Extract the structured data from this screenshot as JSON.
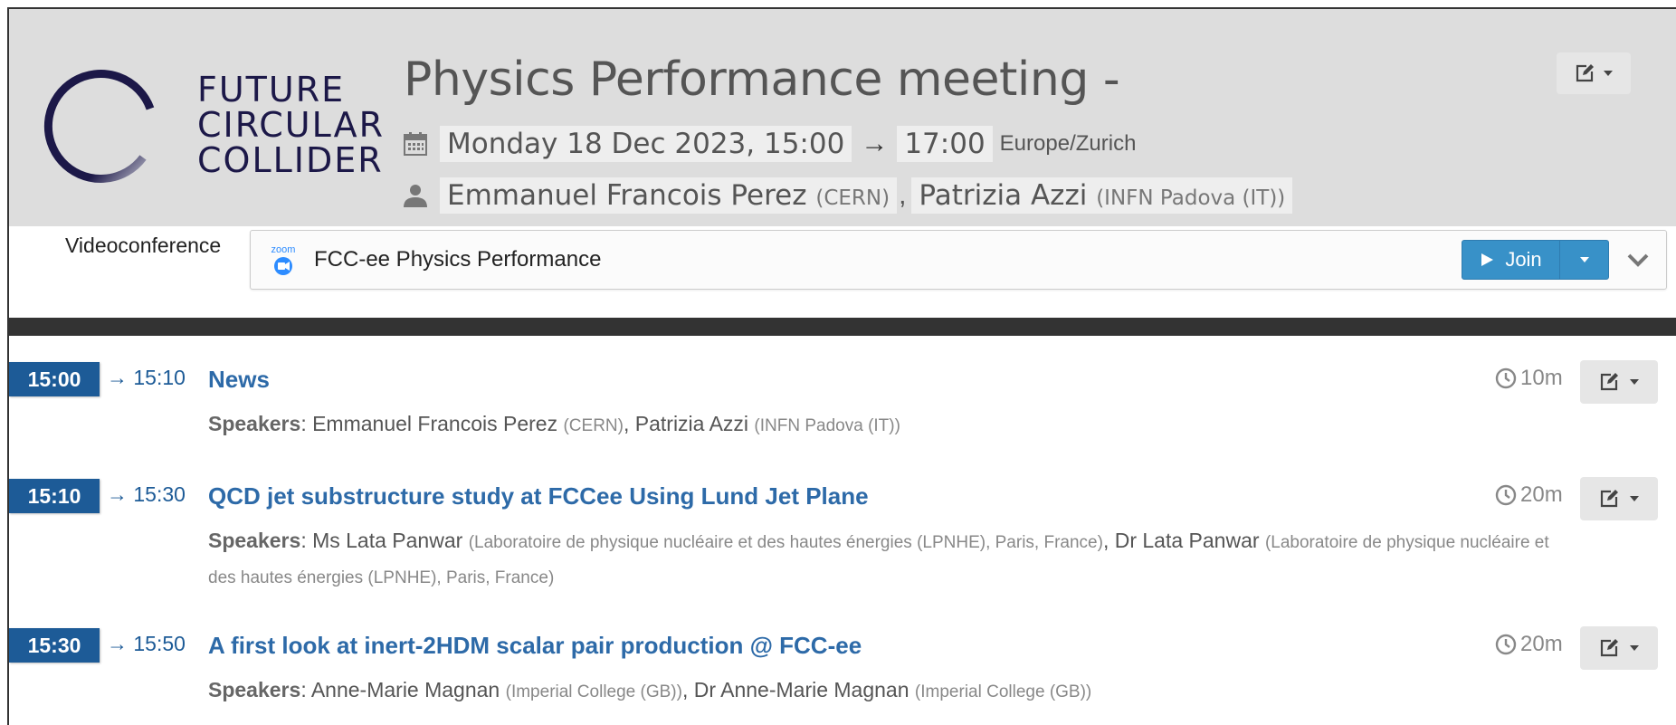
{
  "header": {
    "logo_lines": [
      "FUTURE",
      "CIRCULAR",
      "COLLIDER"
    ],
    "title": "Physics Performance meeting -",
    "date_start": "Monday 18 Dec 2023, 15:00",
    "arrow": "→",
    "date_end": "17:00",
    "timezone": "Europe/Zurich",
    "chairs": [
      {
        "name": "Emmanuel Francois Perez",
        "affiliation": "(CERN)"
      },
      {
        "name": "Patrizia Azzi",
        "affiliation": "(INFN Padova (IT))"
      }
    ],
    "chair_separator": ","
  },
  "videoconference": {
    "label": "Videoconference",
    "zoom_text": "zoom",
    "room_name": "FCC-ee Physics Performance",
    "join_label": "Join"
  },
  "timetable": [
    {
      "start": "15:00",
      "end": "→ 15:10",
      "title": "News",
      "speakers_label": "Speakers",
      "speakers": [
        {
          "name": "Emmanuel Francois Perez",
          "affiliation": "(CERN)"
        },
        {
          "name": "Patrizia Azzi",
          "affiliation": "(INFN Padova (IT))"
        }
      ],
      "duration": "10m"
    },
    {
      "start": "15:10",
      "end": "→ 15:30",
      "title": "QCD jet substructure study at FCCee Using Lund Jet Plane",
      "speakers_label": "Speakers",
      "speakers": [
        {
          "name": "Ms Lata Panwar",
          "affiliation": "(Laboratoire de physique nucléaire et des hautes énergies (LPNHE), Paris, France)"
        },
        {
          "name": "Dr Lata Panwar",
          "affiliation": "(Laboratoire de physique nucléaire et des hautes énergies (LPNHE), Paris, France)"
        }
      ],
      "duration": "20m"
    },
    {
      "start": "15:30",
      "end": "→ 15:50",
      "title": "A first look at inert-2HDM scalar pair production @ FCC-ee",
      "speakers_label": "Speakers",
      "speakers": [
        {
          "name": "Anne-Marie Magnan",
          "affiliation": "(Imperial College (GB))"
        },
        {
          "name": "Dr Anne-Marie Magnan",
          "affiliation": "(Imperial College (GB))"
        }
      ],
      "duration": "20m"
    }
  ],
  "colors": {
    "header_bg": "#dddddd",
    "brand_navy": "#1c1848",
    "badge_blue": "#1d5b97",
    "title_blue": "#2d6aa8",
    "join_blue": "#3891c8"
  }
}
